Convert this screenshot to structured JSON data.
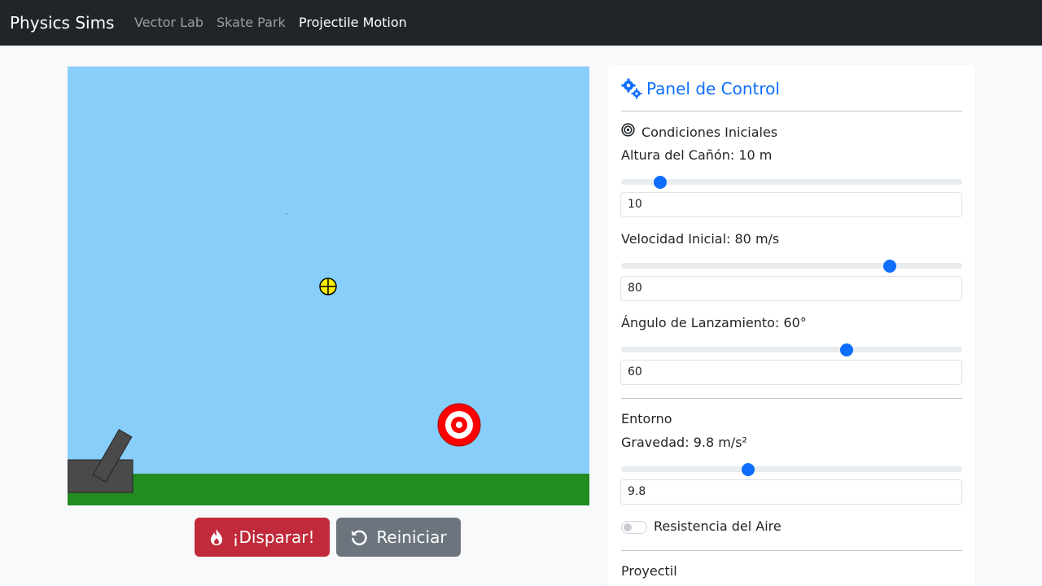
{
  "navbar": {
    "brand": "Physics Sims",
    "links": [
      "Vector Lab",
      "Skate Park",
      "Projectile Motion"
    ],
    "active_index": 2
  },
  "simulation": {
    "sky_color": "#87cefa",
    "ground_color": "#228b22",
    "cannon_color": "#4a4a4a",
    "target_color": "#ff0000"
  },
  "actions": {
    "fire_label": "¡Disparar!",
    "fire_icon": "fire-icon",
    "reset_label": "Reiniciar",
    "reset_icon": "rotate-left-icon"
  },
  "panel": {
    "title": "Panel de Control",
    "title_icon": "gears-icon",
    "initial_conditions": {
      "heading": "Condiciones Iniciales",
      "heading_icon": "bullseye-icon",
      "height": {
        "label": "Altura del Cañón: 10 m",
        "value": "10",
        "fraction": 0.115
      },
      "velocity": {
        "label": "Velocidad Inicial: 80 m/s",
        "value": "80",
        "fraction": 0.79
      },
      "angle": {
        "label": "Ángulo de Lanzamiento: 60°",
        "value": "60",
        "fraction": 0.66
      }
    },
    "environment": {
      "heading": "Entorno",
      "gravity": {
        "label": "Gravedad: 9.8 m/s²",
        "value": "9.8",
        "fraction": 0.37
      },
      "air_resistance": {
        "label": "Resistencia del Aire",
        "enabled": false
      }
    },
    "projectile": {
      "heading": "Proyectil"
    }
  },
  "accent_color": "#0d6efd"
}
